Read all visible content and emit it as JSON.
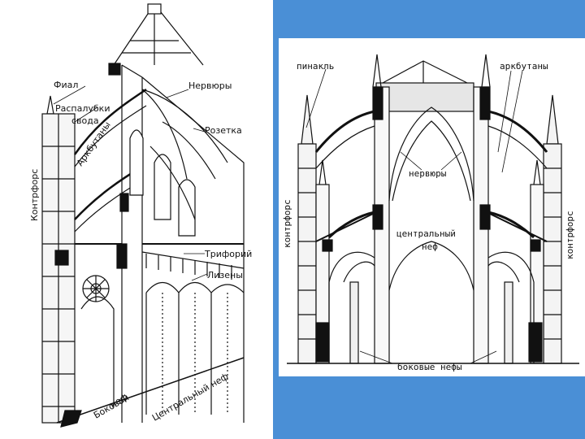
{
  "colors": {
    "panel_blue": "#4a8fd6",
    "ink": "#111111",
    "stone": "#f4f4f4"
  },
  "left_figure": {
    "labels": {
      "fial": "Фиал",
      "raspalubki_line1": "Распалубки",
      "raspalubki_line2": "свода",
      "nervyury": "Нервюры",
      "rozetka": "Розетка",
      "arkbutany": "Аркбутаны",
      "kontrfors": "Контрфорс",
      "triforiy": "Трифорий",
      "lizeny": "Лизены",
      "tsentralny_nef": "Центральный неф",
      "bokovoy_line1": "Боковой",
      "bokovoy_line2": "неф"
    }
  },
  "right_figure": {
    "labels": {
      "pinakl": "пинакль",
      "arkbutany": "аркбутаны",
      "nervyury": "нервюры",
      "tsentralny_line1": "центральный",
      "tsentralny_line2": "неф",
      "kontrfors_left": "контрфорс",
      "kontrfors_right": "контрфорс",
      "bokovye_nefy": "боковые нефы"
    }
  }
}
